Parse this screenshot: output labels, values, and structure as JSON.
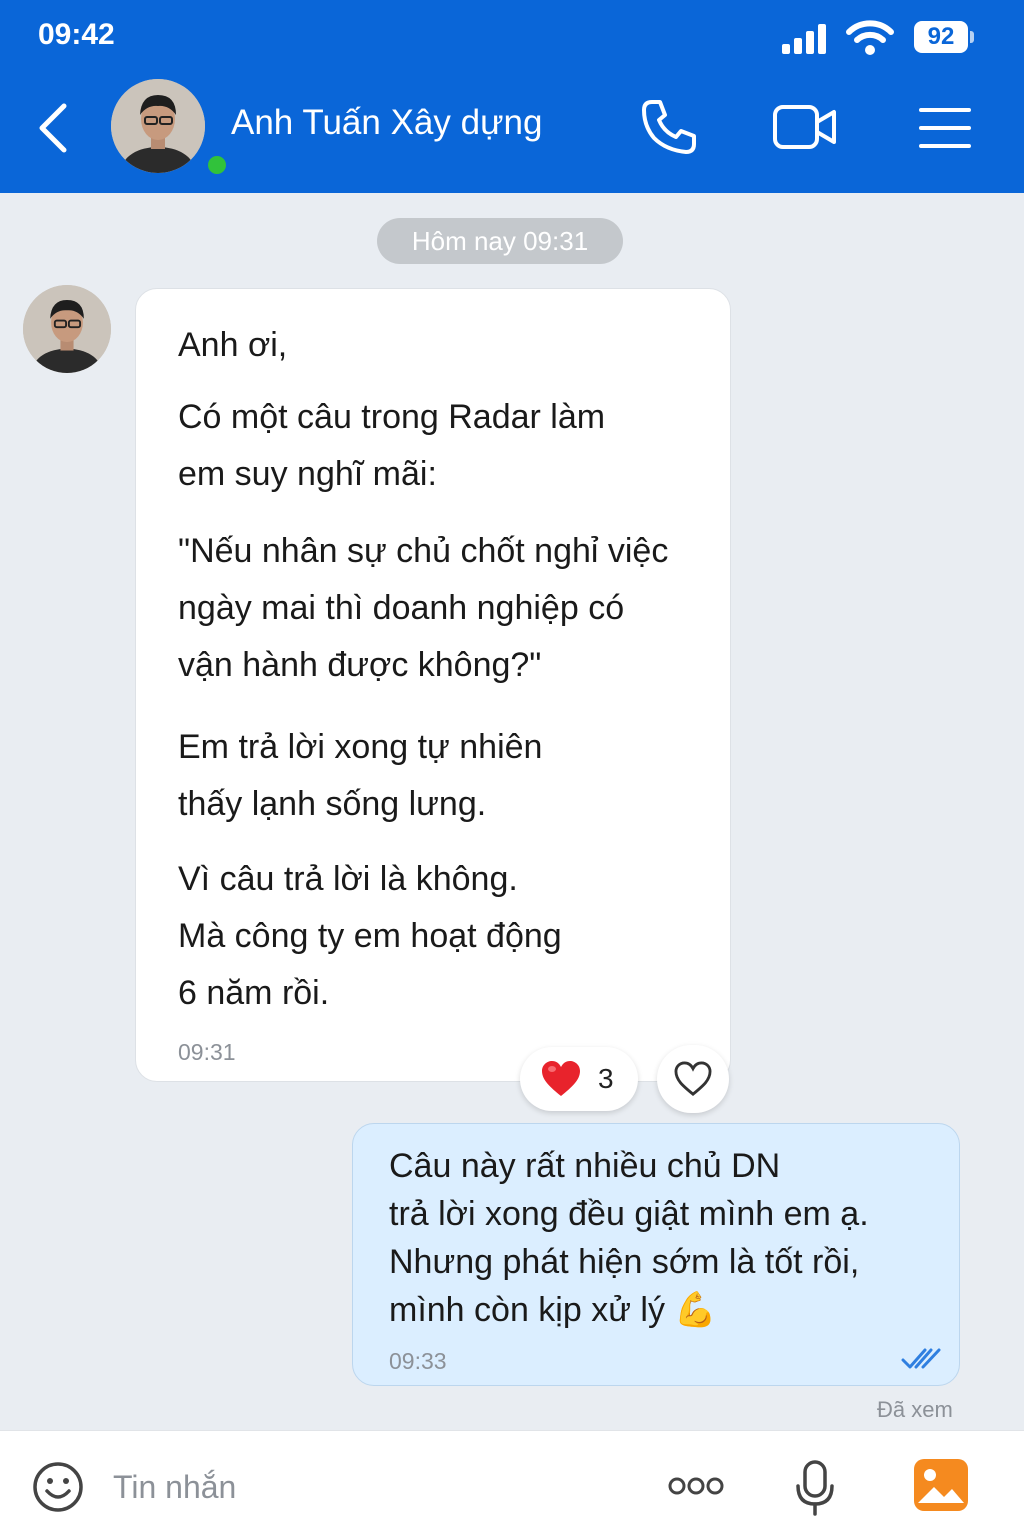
{
  "status_bar": {
    "time": "09:42",
    "battery": "92"
  },
  "header": {
    "contact_name": "Anh Tuấn Xây dựng"
  },
  "chat": {
    "date_label": "Hôm nay 09:31",
    "incoming": {
      "paragraphs": [
        "Anh ơi,",
        "Có một câu trong Radar làm\nem suy nghĩ mãi:",
        "\"Nếu nhân sự chủ chốt nghỉ việc\nngày mai thì doanh nghiệp có\nvận hành được không?\"",
        "Em trả lời xong tự nhiên\nthấy lạnh sống lưng.",
        "Vì câu trả lời là không.\nMà công ty em hoạt động\n6 năm rồi."
      ],
      "time": "09:31",
      "reaction_count": "3"
    },
    "outgoing": {
      "text": "Câu này rất nhiều chủ DN\ntrả lời xong đều giật mình em ạ.\nNhưng phát hiện sớm là tốt rồi,\nmình còn kịp xử lý 💪",
      "time": "09:33",
      "seen_label": "Đã xem"
    }
  },
  "input": {
    "placeholder": "Tin nhắn"
  },
  "colors": {
    "header_bg": "#0a66d8",
    "chat_bg": "#e9edf2",
    "outgoing_bubble": "#dbeeff",
    "online": "#31c23b"
  }
}
